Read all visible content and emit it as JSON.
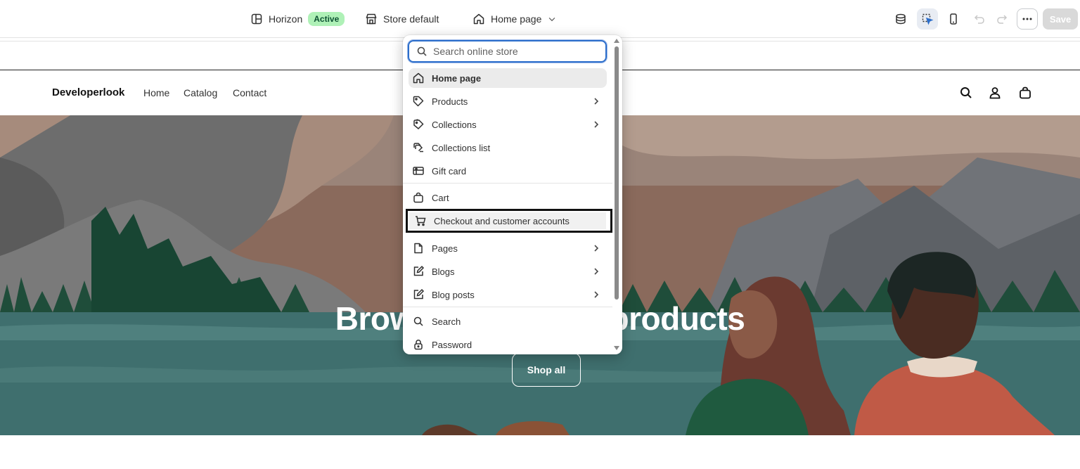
{
  "topbar": {
    "theme_name": "Horizon",
    "theme_status": "Active",
    "store_context": "Store default",
    "page_selector": "Home page",
    "save_label": "Save"
  },
  "dropdown": {
    "search_placeholder": "Search online store",
    "items": [
      {
        "label": "Home page",
        "icon": "home-icon",
        "has_children": false
      },
      {
        "label": "Products",
        "icon": "tag-icon",
        "has_children": true
      },
      {
        "label": "Collections",
        "icon": "collections-icon",
        "has_children": true
      },
      {
        "label": "Collections list",
        "icon": "collections-list-icon",
        "has_children": false
      },
      {
        "label": "Gift card",
        "icon": "gift-card-icon",
        "has_children": false
      },
      {
        "label": "Cart",
        "icon": "bag-icon",
        "has_children": false
      },
      {
        "label": "Checkout and customer accounts",
        "icon": "cart-icon",
        "has_children": false
      },
      {
        "label": "Pages",
        "icon": "page-icon",
        "has_children": true
      },
      {
        "label": "Blogs",
        "icon": "edit-icon",
        "has_children": true
      },
      {
        "label": "Blog posts",
        "icon": "edit-icon",
        "has_children": true
      },
      {
        "label": "Search",
        "icon": "search-icon",
        "has_children": false
      },
      {
        "label": "Password",
        "icon": "lock-icon",
        "has_children": false
      }
    ]
  },
  "store": {
    "brand": "Developerlook",
    "nav": [
      "Home",
      "Catalog",
      "Contact"
    ],
    "hero_title": "Browse our latest products",
    "hero_button": "Shop all"
  },
  "colors": {
    "accent_blue": "#2c6ecb",
    "active_badge_bg": "#aff1b7",
    "active_badge_text": "#0c5132"
  }
}
